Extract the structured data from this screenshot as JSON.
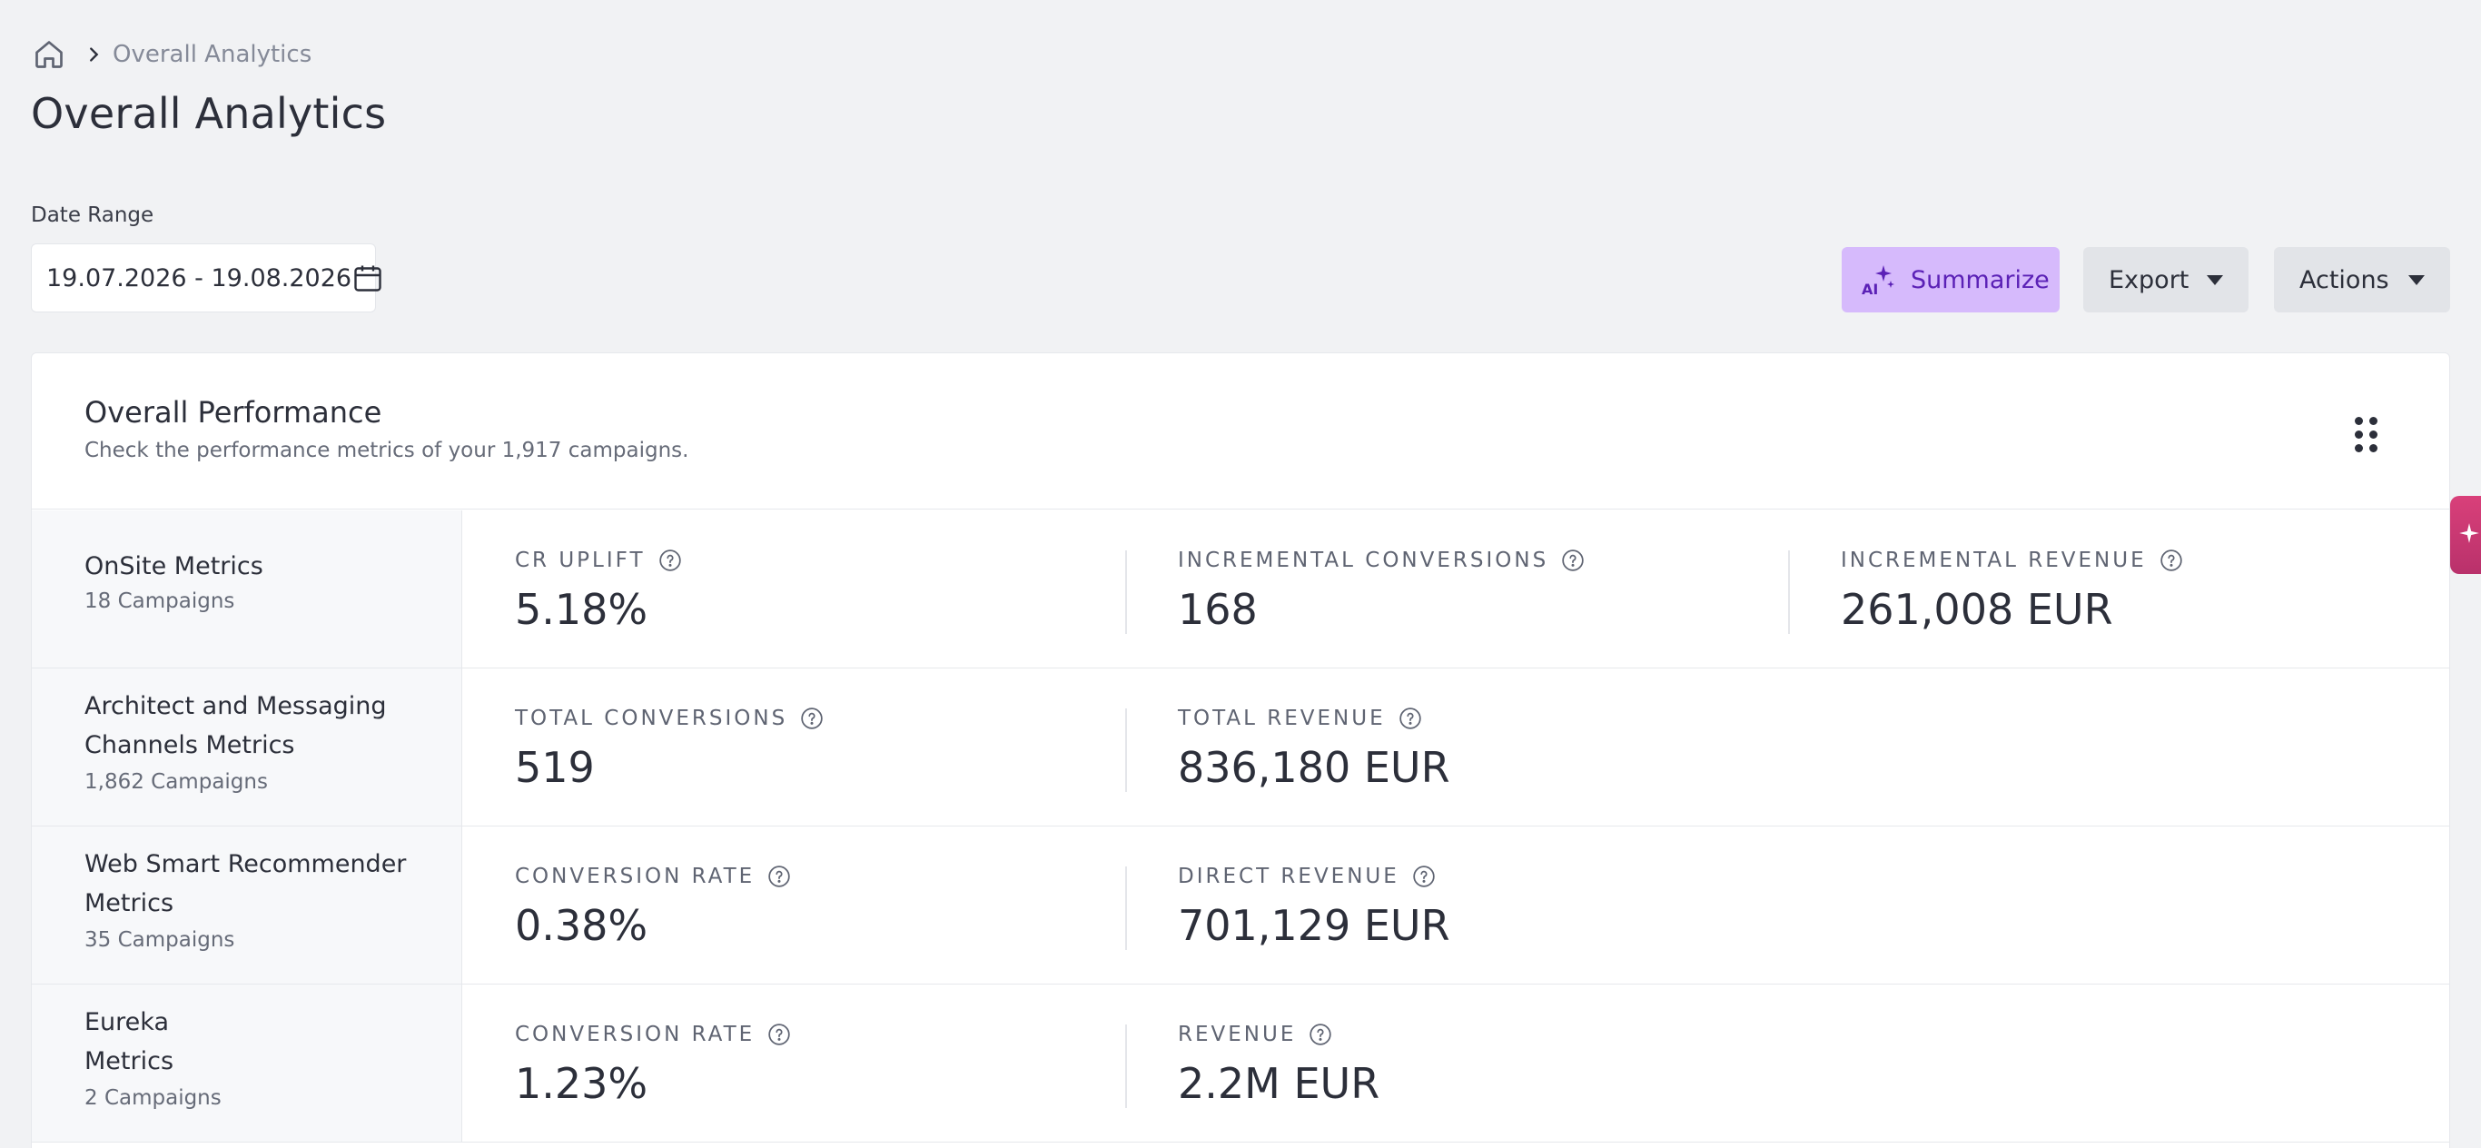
{
  "breadcrumb": {
    "current": "Overall Analytics"
  },
  "page": {
    "title": "Overall Analytics"
  },
  "filters": {
    "date_range_label": "Date Range",
    "date_range_value": "19.07.2026 - 19.08.2026"
  },
  "toolbar": {
    "summarize_label": "Summarize",
    "ai_badge": "AI",
    "export_label": "Export",
    "actions_label": "Actions"
  },
  "card": {
    "title": "Overall Performance",
    "subtitle": "Check the performance metrics of your 1,917 campaigns."
  },
  "rows": [
    {
      "name": "OnSite Metrics",
      "count": "18 Campaigns",
      "metrics": [
        {
          "label": "CR UPLIFT",
          "value": "5.18%"
        },
        {
          "label": "INCREMENTAL CONVERSIONS",
          "value": "168"
        },
        {
          "label": "INCREMENTAL REVENUE",
          "value": "261,008 EUR"
        }
      ]
    },
    {
      "name": "Architect and Messaging Channels Metrics",
      "count": "1,862 Campaigns",
      "metrics": [
        {
          "label": "TOTAL CONVERSIONS",
          "value": "519"
        },
        {
          "label": "TOTAL REVENUE",
          "value": "836,180 EUR"
        }
      ]
    },
    {
      "name": "Web Smart Recommender Metrics",
      "count": "35 Campaigns",
      "metrics": [
        {
          "label": "CONVERSION RATE",
          "value": "0.38%"
        },
        {
          "label": "DIRECT REVENUE",
          "value": "701,129 EUR"
        }
      ]
    },
    {
      "name": "Eureka\nMetrics",
      "count": "2 Campaigns",
      "metrics": [
        {
          "label": "CONVERSION RATE",
          "value": "1.23%"
        },
        {
          "label": "REVENUE",
          "value": "2.2M EUR"
        }
      ]
    }
  ],
  "colors": {
    "accent_purple": "#d6bafc",
    "accent_purple_text": "#5b21b6",
    "side_tab": "#d9407a",
    "background": "#f1f2f4"
  }
}
